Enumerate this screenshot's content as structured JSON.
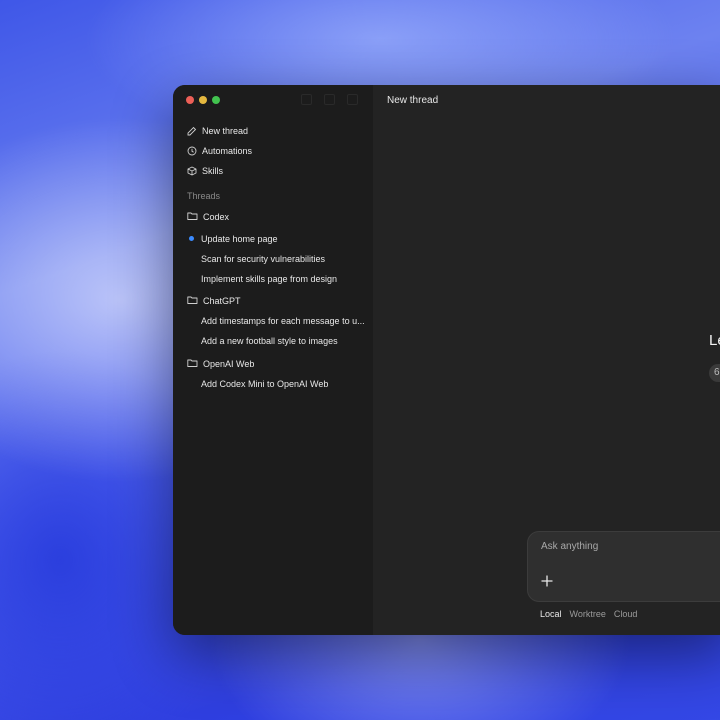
{
  "window": {
    "title": "New thread"
  },
  "sidebar": {
    "nav": [
      {
        "label": "New thread",
        "icon": "edit-icon"
      },
      {
        "label": "Automations",
        "icon": "clock-icon"
      },
      {
        "label": "Skills",
        "icon": "cube-icon"
      }
    ],
    "threads_label": "Threads",
    "groups": [
      {
        "name": "Codex",
        "icon": "folder-icon",
        "threads": [
          "Update home page",
          "Scan for security vulnerabilities",
          "Implement skills page from design"
        ],
        "active_index": 0
      },
      {
        "name": "ChatGPT",
        "icon": "folder-icon",
        "threads": [
          "Add timestamps for each message to u...",
          "Add a new football style to images"
        ]
      },
      {
        "name": "OpenAI Web",
        "icon": "folder-icon",
        "threads": [
          "Add Codex Mini to OpenAI Web"
        ]
      }
    ]
  },
  "main": {
    "hero_title": "Le",
    "hero_chip": "6",
    "composer": {
      "placeholder": "Ask anything",
      "plus_icon": "plus-icon"
    },
    "modes": [
      {
        "label": "Local",
        "selected": true
      },
      {
        "label": "Worktree",
        "selected": false
      },
      {
        "label": "Cloud",
        "selected": false
      }
    ]
  },
  "colors": {
    "window_bg": "#232323",
    "sidebar_bg": "#1c1c1c",
    "active_dot": "#3b8bff"
  }
}
